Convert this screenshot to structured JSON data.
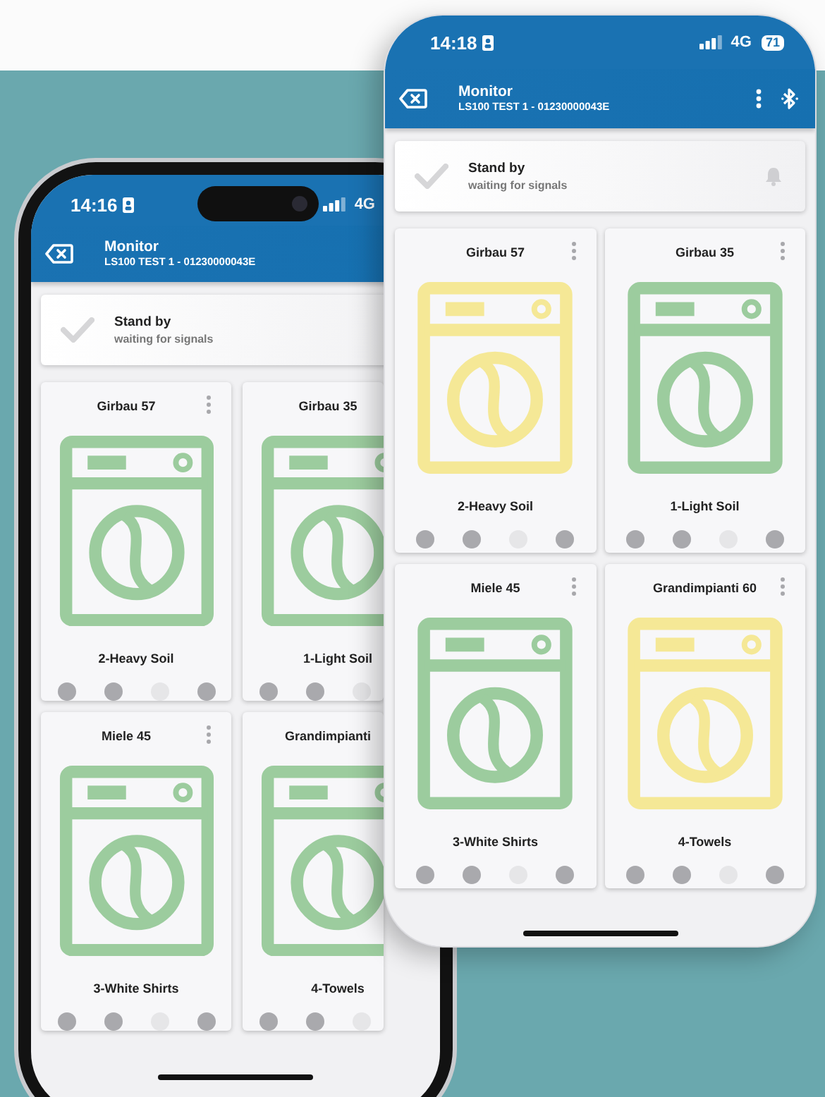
{
  "phones": [
    {
      "status_bar": {
        "time": "14:16",
        "network": "4G"
      },
      "header": {
        "title": "Monitor",
        "subtitle": "LS100 TEST 1 - 01230000043E"
      },
      "status_card": {
        "title": "Stand by",
        "message": "waiting for signals"
      },
      "machines": [
        {
          "name": "Girbau 57",
          "program": "2-Heavy Soil",
          "color": "#9ccc9e",
          "menu": true,
          "lights": [
            {
              "on": true
            },
            {
              "on": true
            },
            {
              "on": false
            },
            {
              "on": true
            }
          ]
        },
        {
          "name": "Girbau 35",
          "program": "1-Light Soil",
          "color": "#9ccc9e",
          "lights": [
            {
              "on": true
            },
            {
              "on": true
            },
            {
              "on": false
            }
          ]
        },
        {
          "name": "Miele 45",
          "program": "3-White Shirts",
          "color": "#9ccc9e",
          "menu": true,
          "lights": [
            {
              "on": true
            },
            {
              "on": true
            },
            {
              "on": false
            },
            {
              "on": true
            }
          ]
        },
        {
          "name": "Grandimpianti",
          "program": "4-Towels",
          "color": "#9ccc9e",
          "lights": [
            {
              "on": true
            },
            {
              "on": true
            },
            {
              "on": false
            }
          ]
        }
      ]
    },
    {
      "status_bar": {
        "time": "14:18",
        "network": "4G",
        "battery": "71"
      },
      "header": {
        "title": "Monitor",
        "subtitle": "LS100 TEST 1 - 01230000043E",
        "menu": true,
        "bluetooth": true
      },
      "status_card": {
        "title": "Stand by",
        "message": "waiting for signals",
        "bell": true
      },
      "machines": [
        {
          "name": "Girbau 57",
          "program": "2-Heavy Soil",
          "color": "#f5e896",
          "menu": true,
          "lights": [
            {
              "on": true
            },
            {
              "on": true
            },
            {
              "on": false
            },
            {
              "on": true
            }
          ]
        },
        {
          "name": "Girbau 35",
          "program": "1-Light Soil",
          "color": "#9ccc9e",
          "menu": true,
          "lights": [
            {
              "on": true
            },
            {
              "on": true
            },
            {
              "on": false
            },
            {
              "on": true
            }
          ]
        },
        {
          "name": "Miele 45",
          "program": "3-White Shirts",
          "color": "#9ccc9e",
          "menu": true,
          "lights": [
            {
              "on": true
            },
            {
              "on": true
            },
            {
              "on": false
            },
            {
              "on": true
            }
          ]
        },
        {
          "name": "Grandimpianti 60",
          "program": "4-Towels",
          "color": "#f5e896",
          "menu": true,
          "lights": [
            {
              "on": true
            },
            {
              "on": true
            },
            {
              "on": false
            },
            {
              "on": true
            }
          ]
        }
      ]
    }
  ]
}
